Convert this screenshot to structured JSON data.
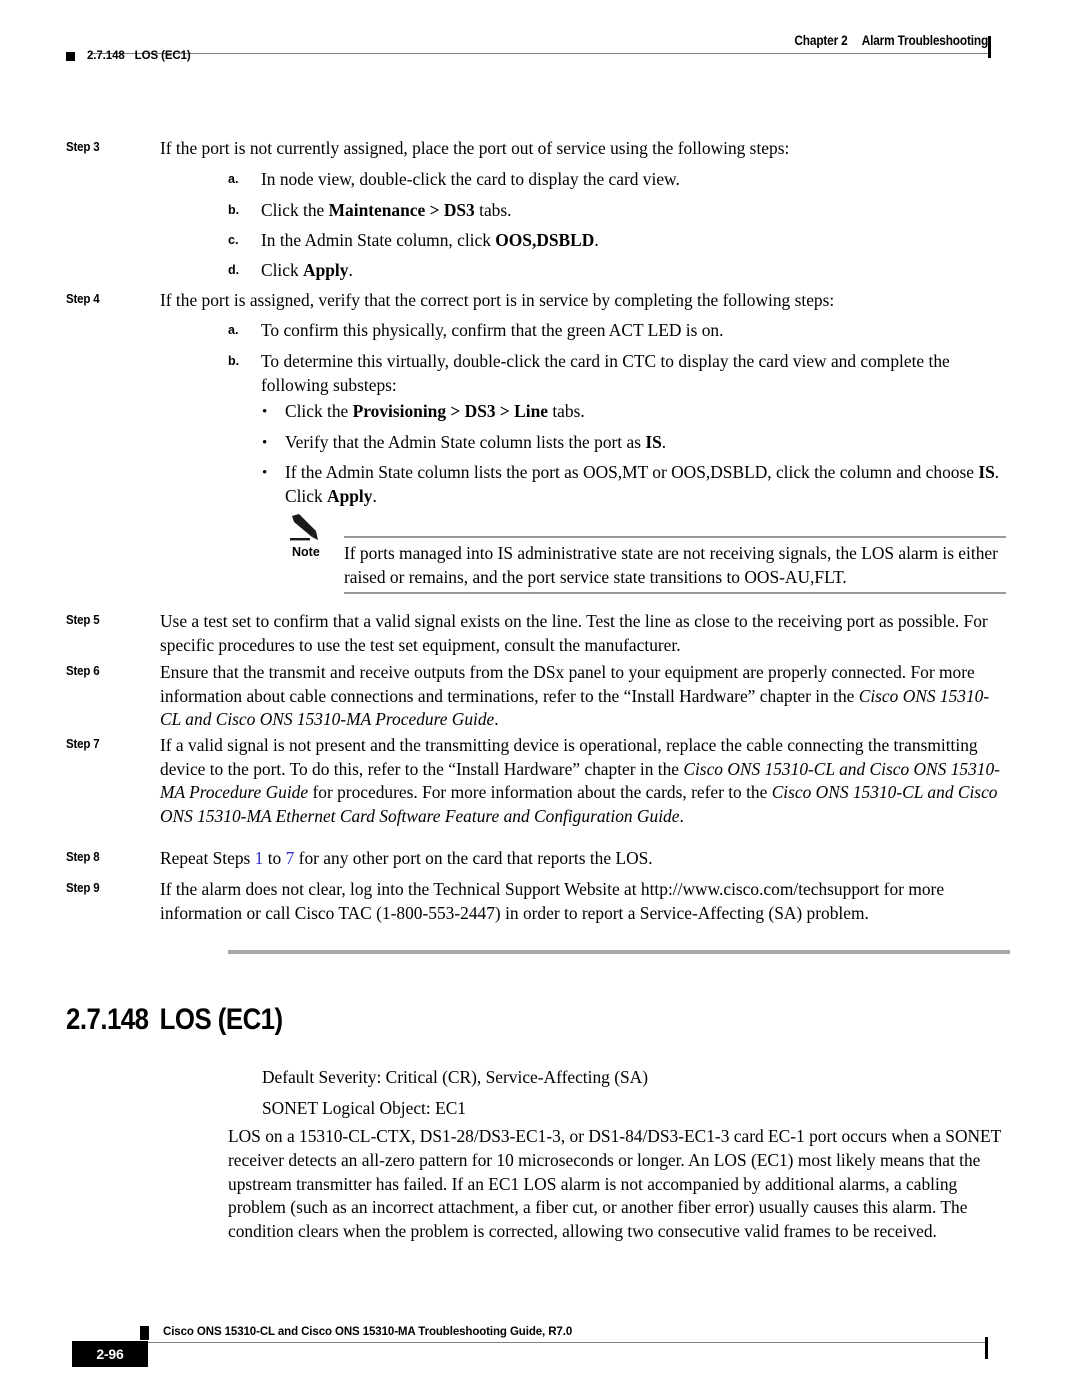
{
  "header": {
    "chapter_num": "Chapter 2",
    "chapter_title": "Alarm Troubleshooting",
    "section_num": "2.7.148",
    "section_title": "LOS (EC1)"
  },
  "steps": [
    {
      "label": "Step 3",
      "text_pre": "If the port is not currently assigned, place the port out of service using the following steps:",
      "substeps": [
        {
          "marker": "a.",
          "pre": "In node view, double-click the card to display the card view.",
          "bold": "",
          "post": ""
        },
        {
          "marker": "b.",
          "pre": "Click the ",
          "bold": "Maintenance > DS3",
          "post": " tabs."
        },
        {
          "marker": "c.",
          "pre": "In the Admin State column, click ",
          "bold": "OOS,DSBLD",
          "post": "."
        },
        {
          "marker": "d.",
          "pre": "Click ",
          "bold": "Apply",
          "post": "."
        }
      ]
    },
    {
      "label": "Step 4",
      "text_pre": "If the port is assigned, verify that the correct port is in service by completing the following steps:",
      "substeps": [
        {
          "marker": "a.",
          "pre": "To confirm this physically, confirm that the green ACT LED is on.",
          "bold": "",
          "post": ""
        },
        {
          "marker": "b.",
          "pre": "To determine this virtually, double-click the card in CTC to display the card view and complete the following substeps:",
          "bold": "",
          "post": ""
        }
      ],
      "bullets": [
        {
          "dot": "•",
          "pre": "Click the ",
          "bold": "Provisioning > DS3 > Line",
          "post": " tabs."
        },
        {
          "dot": "•",
          "pre": "Verify that the Admin State column lists the port as ",
          "bold": "IS",
          "post": "."
        },
        {
          "dot": "•",
          "pre": "If the Admin State column lists the port as OOS,MT or OOS,DSBLD, click the column and choose ",
          "bold": "IS",
          "post": ". Click ",
          "bold2": "Apply",
          "post2": "."
        }
      ]
    },
    {
      "label": "Step 5",
      "text_pre": "Use a test set to confirm that a valid signal exists on the line. Test the line as close to the receiving port as possible. For specific procedures to use the test set equipment, consult the manufacturer."
    },
    {
      "label": "Step 6",
      "seg1": "Ensure that the transmit and receive outputs from the DSx panel to your equipment are properly connected. For more information about cable connections and terminations, refer to the “Install Hardware” chapter in the ",
      "italic1": "Cisco ONS 15310-CL and Cisco ONS 15310-MA Procedure Guide",
      "seg2": "."
    },
    {
      "label": "Step 7",
      "seg1": "If a valid signal is not present and the transmitting device is operational, replace the cable connecting the transmitting device to the port. To do this, refer to the “Install Hardware” chapter in the ",
      "italic1": "Cisco ONS 15310-CL and Cisco ONS 15310-MA Procedure Guide",
      "seg2": " for procedures. For more information about the cards, refer to the ",
      "italic2": "Cisco ONS 15310-CL and Cisco ONS 15310-MA Ethernet Card Software Feature and Configuration Guide",
      "seg3": "."
    },
    {
      "label": "Step 8",
      "seg1": "Repeat Steps ",
      "link1": "1",
      "seg2": " to ",
      "link2": "7",
      "seg3": " for any other port on the card that reports the LOS."
    },
    {
      "label": "Step 9",
      "text_pre": "If the alarm does not clear, log into the Technical Support Website at http://www.cisco.com/techsupport for more information or call Cisco TAC (1-800-553-2447) in order to report a Service-Affecting (SA) problem."
    }
  ],
  "note": {
    "label": "Note",
    "text": "If ports managed into IS administrative state are not receiving signals, the LOS alarm is either raised or remains, and the port service state transitions to OOS-AU,FLT."
  },
  "section": {
    "number": "2.7.148",
    "title": "LOS (EC1)",
    "severity": "Default Severity: Critical (CR), Service-Affecting (SA)",
    "logical_object": "SONET Logical Object: EC1",
    "description": "LOS on a 15310-CL-CTX, DS1-28/DS3-EC1-3, or DS1-84/DS3-EC1-3 card EC-1 port occurs when a SONET receiver detects an all-zero pattern for 10 microseconds or longer. An LOS (EC1) most likely means that the upstream transmitter has failed. If an EC1 LOS alarm is not accompanied by additional alarms, a cabling problem (such as an incorrect attachment, a fiber cut, or another fiber error) usually causes this alarm. The condition clears when the problem is corrected, allowing two consecutive valid frames to be received."
  },
  "footer": {
    "guide_title": "Cisco ONS 15310-CL and Cisco ONS 15310-MA Troubleshooting Guide, R7.0",
    "page_number": "2-96"
  },
  "colors": {
    "link": "#3030c8",
    "rule": "#808080",
    "section_rule": "#a8a8a8"
  }
}
